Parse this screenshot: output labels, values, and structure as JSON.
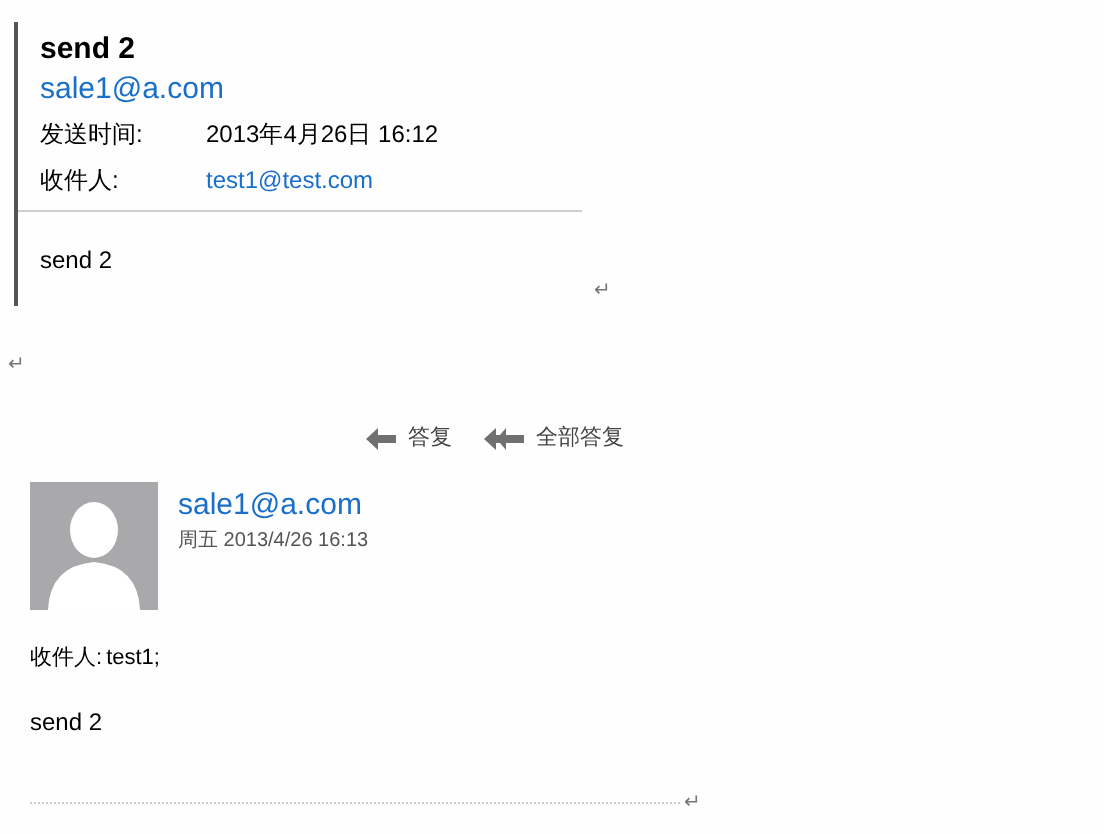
{
  "quoted_message": {
    "subject": "send 2",
    "sender": "sale1@a.com",
    "fields": [
      {
        "label": "发送时间:",
        "value": "2013年4月26日  16:12",
        "kind": "text"
      },
      {
        "label": "收件人:",
        "value": "test1@test.com",
        "kind": "link"
      }
    ],
    "body": "send 2",
    "paragraph_mark": "↵"
  },
  "paragraph_mark": "↵",
  "actions": [
    {
      "label": "答复",
      "kind": "reply"
    },
    {
      "label": "全部答复",
      "kind": "reply-all"
    }
  ],
  "message": {
    "sender": "sale1@a.com",
    "date": "周五 2013/4/26 16:13",
    "recipients_label": "收件人:",
    "recipients": "test1;",
    "body": "send 2",
    "paragraph_mark": "↵"
  }
}
